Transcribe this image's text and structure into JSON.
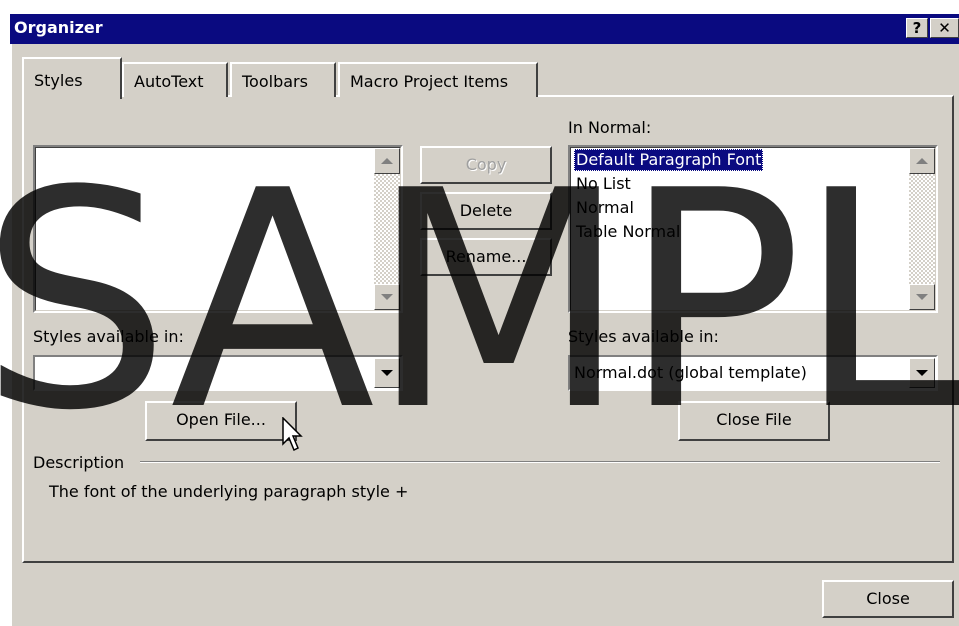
{
  "window": {
    "title": "Organizer",
    "help_label": "?",
    "close_label": "✕"
  },
  "tabs": [
    {
      "label": "Styles",
      "active": true
    },
    {
      "label": "AutoText",
      "active": false
    },
    {
      "label": "Toolbars",
      "active": false
    },
    {
      "label": "Macro Project Items",
      "active": false
    }
  ],
  "left_panel": {
    "list_items": [],
    "available_label": "Styles available in:",
    "available_value": "",
    "open_file_label": "Open File..."
  },
  "middle_buttons": {
    "copy_label": "Copy",
    "delete_label": "Delete",
    "rename_label": "Rename..."
  },
  "right_panel": {
    "header_label": "In Normal:",
    "list_items": [
      "Default Paragraph Font",
      "No List",
      "Normal",
      "Table Normal"
    ],
    "selected_item": "Default Paragraph Font",
    "available_label": "Styles available in:",
    "available_value": "Normal.dot (global template)",
    "close_file_label": "Close File"
  },
  "description": {
    "label": "Description",
    "text": "The font of the underlying paragraph style +"
  },
  "footer": {
    "close_label": "Close"
  },
  "watermark": {
    "text": "SAMPL"
  }
}
